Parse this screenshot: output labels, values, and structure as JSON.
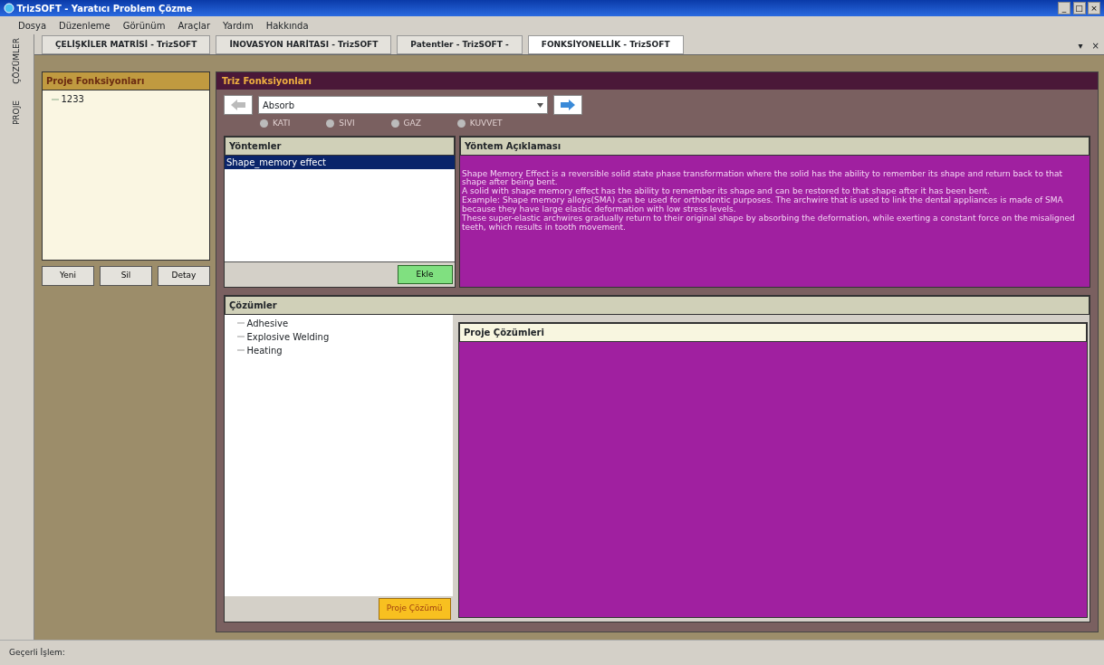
{
  "window": {
    "title": "TrizSOFT - Yaratıcı Problem Çözme",
    "controls": [
      "_",
      "□",
      "×"
    ]
  },
  "menu": [
    "Dosya",
    "Düzenleme",
    "Görünüm",
    "Araçlar",
    "Yardım",
    "Hakkında"
  ],
  "side_tabs": [
    "ÇÖZÜMLER",
    "PROJE"
  ],
  "tabs": [
    {
      "label": "ÇELİŞKİLER MATRİSİ - TrizSOFT",
      "selected": false
    },
    {
      "label": "İNOVASYON HARİTASI - TrizSOFT",
      "selected": false
    },
    {
      "label": "Patentler - TrizSOFT -",
      "selected": false
    },
    {
      "label": "FONKSİYONELLİK - TrizSOFT",
      "selected": true
    }
  ],
  "tab_controls": [
    "▾",
    "×"
  ],
  "project_functions": {
    "title": "Proje Fonksiyonları",
    "items": [
      "1233"
    ],
    "buttons": [
      "Yeni",
      "Sil",
      "Detay"
    ]
  },
  "triz_functions": {
    "title": "Triz Fonksiyonları",
    "combo": {
      "value": "Absorb"
    },
    "states": [
      {
        "label": "KATI",
        "selected": false
      },
      {
        "label": "SIVI",
        "selected": false
      },
      {
        "label": "GAZ",
        "selected": false
      },
      {
        "label": "KUVVET",
        "selected": false
      }
    ],
    "methods": {
      "title": "Yöntemler",
      "items": [
        {
          "label": "Shape_memory effect",
          "selected": true
        }
      ],
      "button": "Ekle"
    },
    "description": {
      "title": "Yöntem Açıklaması",
      "paragraphs": [
        "Shape Memory Effect is a reversible solid state phase transformation where the solid has the ability to remember its shape and return back to that shape after being bent.",
        "A solid with shape memory effect has the ability to remember its shape and can be restored to that shape after it has been bent.",
        "Example: Shape memory alloys(SMA) can be used for orthodontic purposes. The archwire that is used to link the dental appliances is made of SMA because they have large elastic deformation with low stress levels.",
        "These super-elastic archwires gradually return to their original shape by absorbing the deformation, while exerting a constant force on the misaligned teeth, which results in tooth movement."
      ]
    },
    "solutions": {
      "title": "Çözümler",
      "items": [
        "Adhesive",
        "Explosive Welding",
        "Heating"
      ],
      "button": "Proje Çözümü",
      "project_title": "Proje Çözümleri"
    }
  },
  "status_bar": "Geçerli İşlem:"
}
